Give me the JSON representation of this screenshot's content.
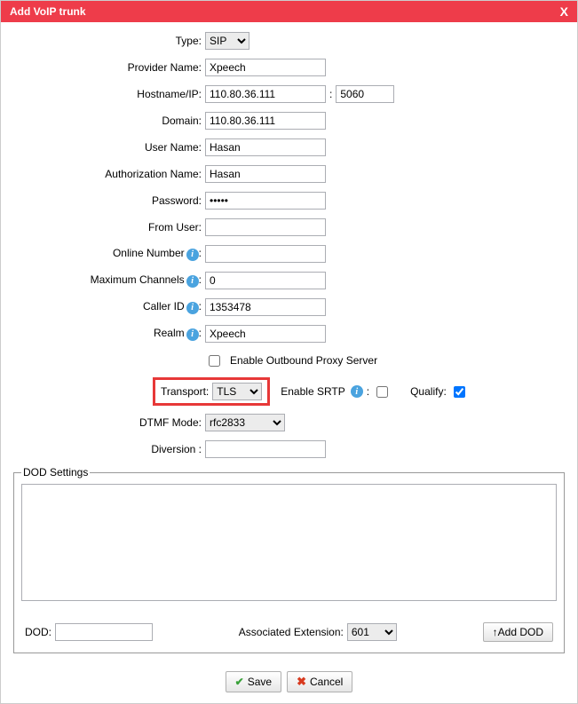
{
  "header": {
    "title": "Add VoIP trunk",
    "close": "X"
  },
  "fields": {
    "type": {
      "label": "Type:",
      "value": "SIP"
    },
    "provider_name": {
      "label": "Provider Name:",
      "value": "Xpeech"
    },
    "hostname": {
      "label": "Hostname/IP:",
      "value": "110.80.36.111",
      "port": "5060"
    },
    "domain": {
      "label": "Domain:",
      "value": "110.80.36.111"
    },
    "user_name": {
      "label": "User Name:",
      "value": "Hasan"
    },
    "auth_name": {
      "label": "Authorization Name:",
      "value": "Hasan"
    },
    "password": {
      "label": "Password:",
      "value": "•••••"
    },
    "from_user": {
      "label": "From User:",
      "value": ""
    },
    "online_number": {
      "label": "Online Number",
      "value": ""
    },
    "max_channels": {
      "label": "Maximum Channels",
      "value": "0"
    },
    "caller_id": {
      "label": "Caller ID",
      "value": "1353478"
    },
    "realm": {
      "label": "Realm",
      "value": "Xpeech"
    },
    "proxy": {
      "label": "Enable Outbound Proxy Server",
      "checked": false
    },
    "transport": {
      "label": "Transport:",
      "value": "TLS"
    },
    "srtp": {
      "label": "Enable SRTP",
      "checked": false
    },
    "qualify": {
      "label": "Qualify:",
      "checked": true
    },
    "dtmf": {
      "label": "DTMF Mode:",
      "value": "rfc2833"
    },
    "diversion": {
      "label": "Diversion :",
      "value": ""
    }
  },
  "dod": {
    "legend": "DOD Settings",
    "dod_label": "DOD:",
    "dod_value": "",
    "assoc_label": "Associated Extension:",
    "assoc_value": "601",
    "add_btn": "↑Add DOD"
  },
  "footer": {
    "save": "Save",
    "cancel": "Cancel"
  }
}
